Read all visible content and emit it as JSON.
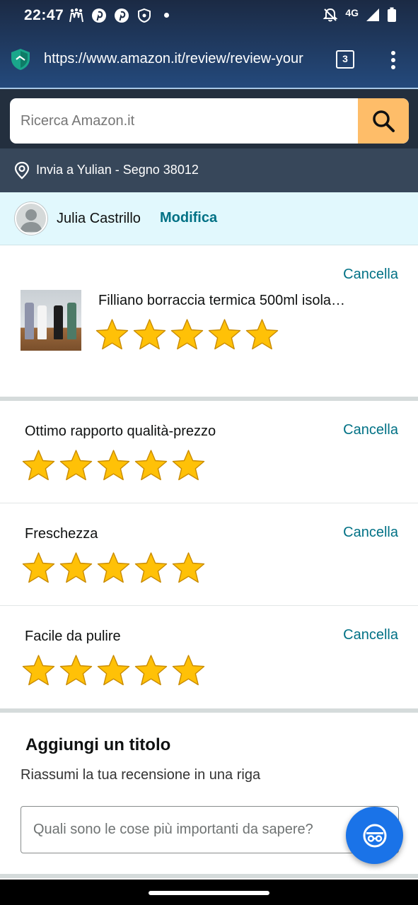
{
  "status_bar": {
    "time": "22:47",
    "network": "4G"
  },
  "browser": {
    "url": "https://www.amazon.it/review/review-your",
    "tab_count": "3"
  },
  "search": {
    "placeholder": "Ricerca Amazon.it"
  },
  "delivery": {
    "text": "Invia a Yulian - Segno 38012"
  },
  "user": {
    "name": "Julia Castrillo",
    "edit_label": "Modifica"
  },
  "product": {
    "title": "Filliano borraccia termica 500ml isola…",
    "cancel_label": "Cancella",
    "rating": 5,
    "max_rating": 5
  },
  "attributes": [
    {
      "label": "Ottimo rapporto qualità-prezzo",
      "cancel_label": "Cancella",
      "rating": 5
    },
    {
      "label": "Freschezza",
      "cancel_label": "Cancella",
      "rating": 5
    },
    {
      "label": "Facile da pulire",
      "cancel_label": "Cancella",
      "rating": 5
    }
  ],
  "title_section": {
    "heading": "Aggiungi un titolo",
    "subtext": "Riassumi la tua recensione in una riga",
    "placeholder": "Quali sono le cose più importanti da sapere?"
  },
  "colors": {
    "header_dark": "#232f3e",
    "delivery_bar": "#37475a",
    "search_button": "#febd69",
    "link_teal": "#007185",
    "user_bar": "#e1f8fd",
    "star_fill": "#ffc107",
    "fab_blue": "#1a73e8"
  },
  "icons": {
    "search": "magnifier-icon",
    "location": "location-pin-icon",
    "shield": "browser-shield-icon",
    "fab": "incognito-mask-icon"
  }
}
